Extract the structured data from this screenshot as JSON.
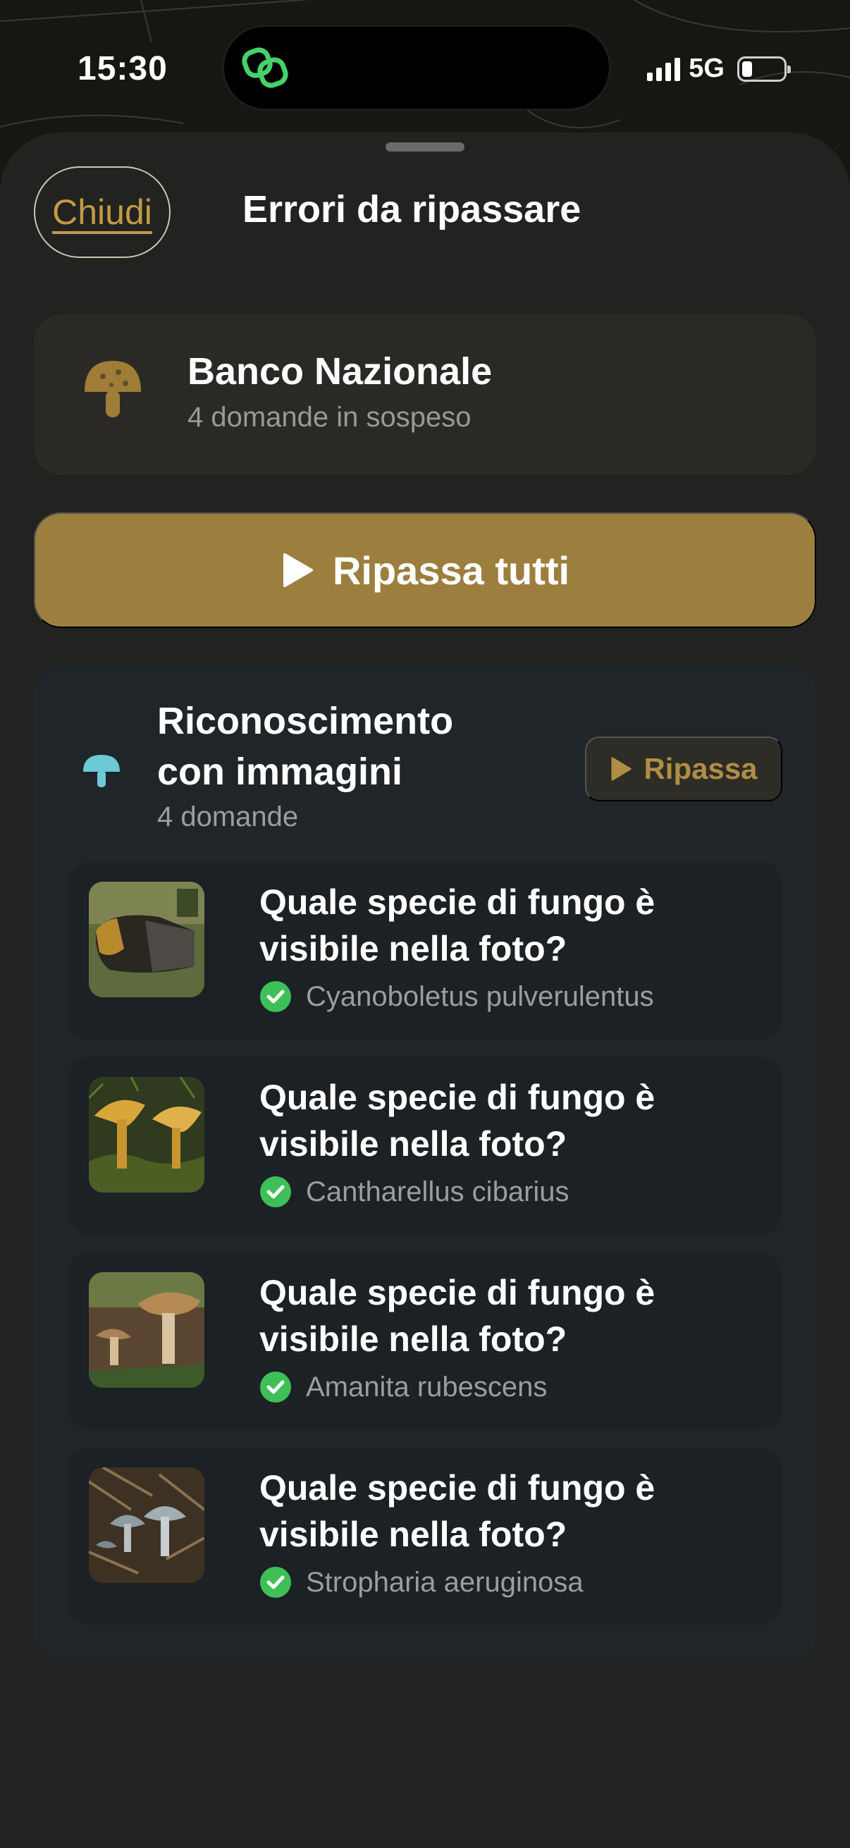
{
  "status_bar": {
    "time": "15:30",
    "network": "5G",
    "battery_level": 0.2,
    "signal_bars": 4
  },
  "sheet": {
    "close_label": "Chiudi",
    "title": "Errori da ripassare"
  },
  "bank": {
    "name": "Banco Nazionale",
    "pending": "4 domande in sospeso",
    "icon": "mushroom-icon"
  },
  "review_all": {
    "label": "Ripassa tutti",
    "icon": "play-icon"
  },
  "category": {
    "title": "Riconoscimento con immagini",
    "count": "4 domande",
    "review_label": "Ripassa",
    "icon": "mushroom-icon"
  },
  "questions": [
    {
      "text": "Quale specie di fungo è visibile nella foto?",
      "answer": "Cyanoboletus pulverulentus"
    },
    {
      "text": "Quale specie di fungo è visibile nella foto?",
      "answer": "Cantharellus cibarius"
    },
    {
      "text": "Quale specie di fungo è visibile nella foto?",
      "answer": "Amanita rubescens"
    },
    {
      "text": "Quale specie di fungo è visibile nella foto?",
      "answer": "Stropharia aeruginosa"
    }
  ],
  "colors": {
    "accent_gold": "#9c7f3f",
    "link_gold": "#c49a45",
    "check_green": "#3fbf57",
    "teal_icon": "#6cc9d6",
    "sheet_bg": "#222221",
    "card_bg": "#1f2528"
  }
}
